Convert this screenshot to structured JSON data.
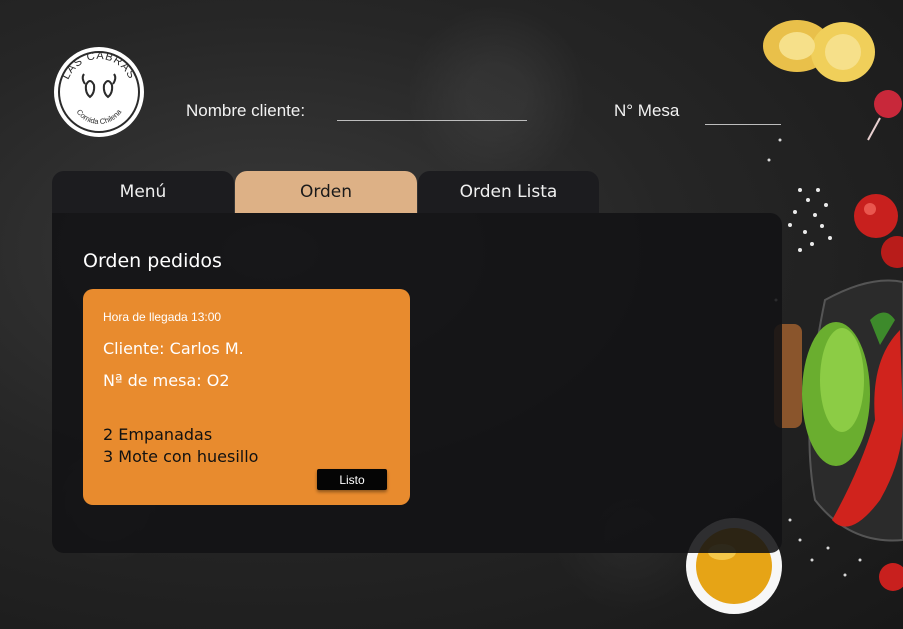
{
  "brand": {
    "name": "LAS CABRAS",
    "tagline": "Comida Chilena"
  },
  "header": {
    "client_label": "Nombre cliente:",
    "client_value": "",
    "table_label": "N° Mesa",
    "table_value": ""
  },
  "tabs": [
    {
      "label": "Menú",
      "active": false
    },
    {
      "label": "Orden",
      "active": true
    },
    {
      "label": "Orden Lista",
      "active": false
    }
  ],
  "panel": {
    "title": "Orden pedidos"
  },
  "orders": [
    {
      "arrival": "Hora de llegada 13:00",
      "client": "Cliente: Carlos M.",
      "table": "Nª de mesa: O2",
      "items": [
        "2 Empanadas",
        "3 Mote con huesillo"
      ],
      "action_label": "Listo"
    }
  ],
  "colors": {
    "tab_active": "#ddb186",
    "tab_inactive": "#1c1c1f",
    "card": "#e88b2e",
    "button": "#050505"
  }
}
